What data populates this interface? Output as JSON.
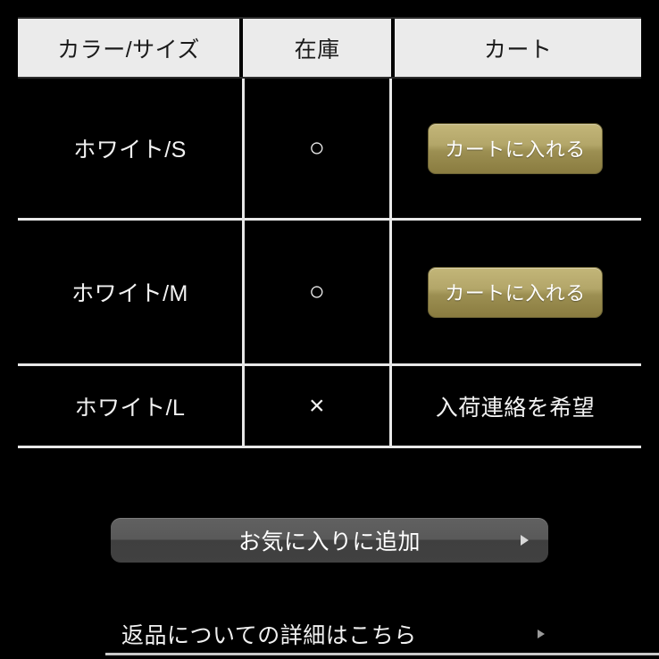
{
  "page": {
    "background_color": "#000000",
    "text_color": "#f2f2f2"
  },
  "variant_table": {
    "columns": [
      {
        "id": "color-size",
        "label": "カラー/サイズ"
      },
      {
        "id": "stock",
        "label": "在庫"
      },
      {
        "id": "cart",
        "label": "カート"
      }
    ],
    "header_background": "#ebebeb",
    "header_text_color": "#1a1a1a",
    "rows": [
      {
        "variant": "ホワイト/S",
        "stock_symbol": "○",
        "stock_state": "in-stock",
        "action_type": "button",
        "action_label": "カートに入れる"
      },
      {
        "variant": "ホワイト/M",
        "stock_symbol": "○",
        "stock_state": "in-stock",
        "action_type": "button",
        "action_label": "カートに入れる"
      },
      {
        "variant": "ホワイト/L",
        "stock_symbol": "×",
        "stock_state": "out-of-stock",
        "action_type": "link",
        "action_label": "入荷連絡を希望"
      }
    ]
  },
  "cart_button": {
    "gradient_top": "#c3b679",
    "gradient_bottom": "#8a7c40",
    "text_color": "#ffffff"
  },
  "favorite_button": {
    "label": "お気に入りに追加",
    "arrow_icon": "triangle-right-icon",
    "gradient_top": "#616161",
    "gradient_bottom": "#414141"
  },
  "return_policy_link": {
    "label": "返品についての詳細はこちら",
    "arrow_icon": "triangle-right-icon"
  }
}
